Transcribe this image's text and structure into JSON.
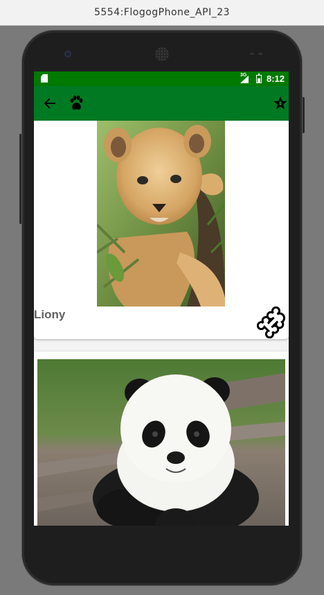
{
  "window": {
    "title": "5554:FlogogPhone_API_23"
  },
  "statusbar": {
    "network": "3G",
    "time": "8:12"
  },
  "appbar": {
    "back_icon": "arrow-left-icon",
    "logo_icon": "paw-icon",
    "action_icon": "star-badge-icon"
  },
  "pets": [
    {
      "name": "Liony",
      "photo": "lion-cub-photo",
      "action_icon": "bone-icon"
    },
    {
      "name": "",
      "photo": "panda-cub-photo"
    }
  ],
  "colors": {
    "status_bar": "#007a00",
    "app_bar": "#007a22",
    "text_secondary": "#616161"
  }
}
